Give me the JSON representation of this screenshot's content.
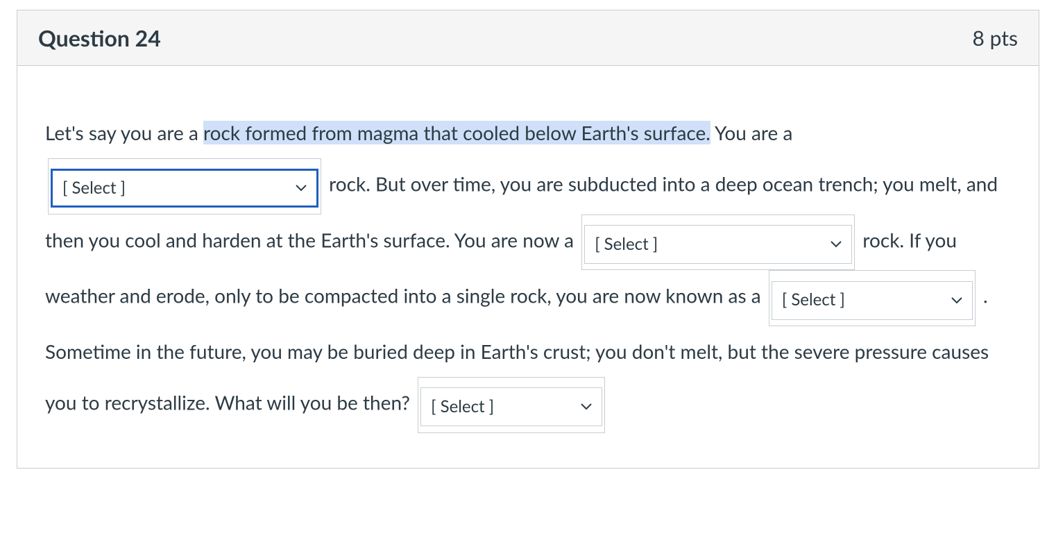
{
  "header": {
    "title": "Question 24",
    "points": "8 pts"
  },
  "body": {
    "t1": "Let's say you are a ",
    "highlight": "rock formed from magma that cooled below Earth's surface.",
    "t2": " You are a ",
    "t3": " rock. But over time, you are subducted into a deep ocean trench; you melt, and then you cool and harden at the Earth's surface. You are now a ",
    "t4": " rock. If you weather and erode, only to be compacted into a single rock, you are now known as a ",
    "t5": " . Sometime in the future, you may be buried deep in Earth's crust; you don't melt, but the severe pressure causes you to recrystallize. What will you be then? "
  },
  "selects": {
    "placeholder": "[ Select ]"
  }
}
